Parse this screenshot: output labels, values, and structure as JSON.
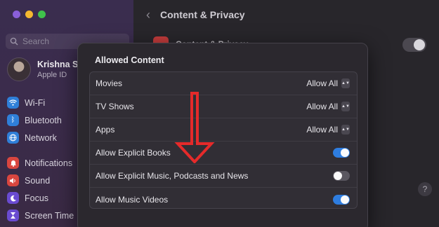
{
  "sidebar": {
    "search_placeholder": "Search",
    "profile": {
      "name": "Krishna Si",
      "subtitle": "Apple ID"
    },
    "items": [
      {
        "label": "Wi-Fi",
        "icon": "wifi-icon",
        "color": "#2f7fd8"
      },
      {
        "label": "Bluetooth",
        "icon": "bluetooth-icon",
        "color": "#2f7fd8"
      },
      {
        "label": "Network",
        "icon": "globe-icon",
        "color": "#2f7fd8"
      },
      {
        "label": "Notifications",
        "icon": "bell-icon",
        "color": "#d9463f"
      },
      {
        "label": "Sound",
        "icon": "speaker-icon",
        "color": "#d9463f"
      },
      {
        "label": "Focus",
        "icon": "moon-icon",
        "color": "#6a4bd1"
      },
      {
        "label": "Screen Time",
        "icon": "hourglass-icon",
        "color": "#6a4bd1"
      }
    ]
  },
  "header": {
    "title": "Content & Privacy"
  },
  "background_row": {
    "label": "Content & Privacy"
  },
  "help": "?",
  "dialog": {
    "title": "Allowed Content",
    "rows": [
      {
        "label": "Movies",
        "type": "select",
        "value": "Allow All"
      },
      {
        "label": "TV Shows",
        "type": "select",
        "value": "Allow All"
      },
      {
        "label": "Apps",
        "type": "select",
        "value": "Allow All"
      },
      {
        "label": "Allow Explicit Books",
        "type": "toggle",
        "on": true
      },
      {
        "label": "Allow Explicit Music, Podcasts and News",
        "type": "toggle",
        "on": false
      },
      {
        "label": "Allow Music Videos",
        "type": "toggle",
        "on": true
      }
    ]
  },
  "colors": {
    "accent": "#2e7de0",
    "annotation": "#e52a2a"
  }
}
